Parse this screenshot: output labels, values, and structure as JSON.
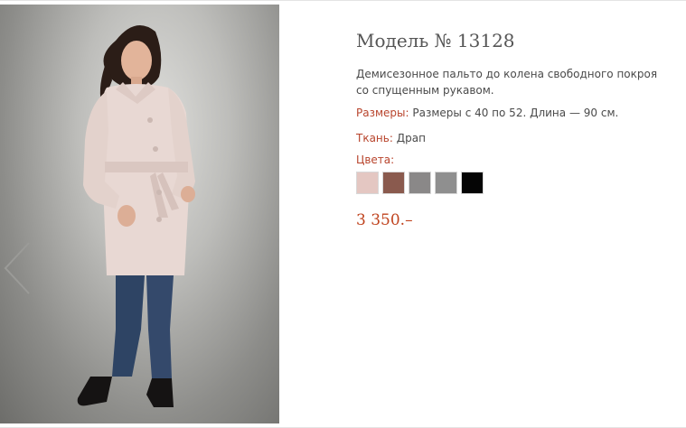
{
  "product": {
    "title": "Модель № 13128",
    "description": "Демисезонное пальто до колена свободного покроя со спущенным рукавом.",
    "sizes_label": "Размеры:",
    "sizes_value": "Размеры с 40 по 52. Длина — 90 см.",
    "fabric_label": "Ткань:",
    "fabric_value": "Драп",
    "colors_label": "Цвета:",
    "colors": [
      {
        "name": "powder-pink",
        "hex": "#e4c7c2"
      },
      {
        "name": "brown-melange",
        "hex": "#8a5a4e"
      },
      {
        "name": "gray-melange",
        "hex": "#8a8888"
      },
      {
        "name": "gray",
        "hex": "#8f8f8f"
      },
      {
        "name": "black",
        "hex": "#050505"
      }
    ],
    "price": "3 350.–"
  },
  "gallery": {
    "prev_icon": "chevron-left-icon",
    "photo": "model-in-pink-coat-photo"
  },
  "theme": {
    "accent": "#c0441f",
    "label": "#b8442c",
    "text": "#4a4a4a"
  }
}
